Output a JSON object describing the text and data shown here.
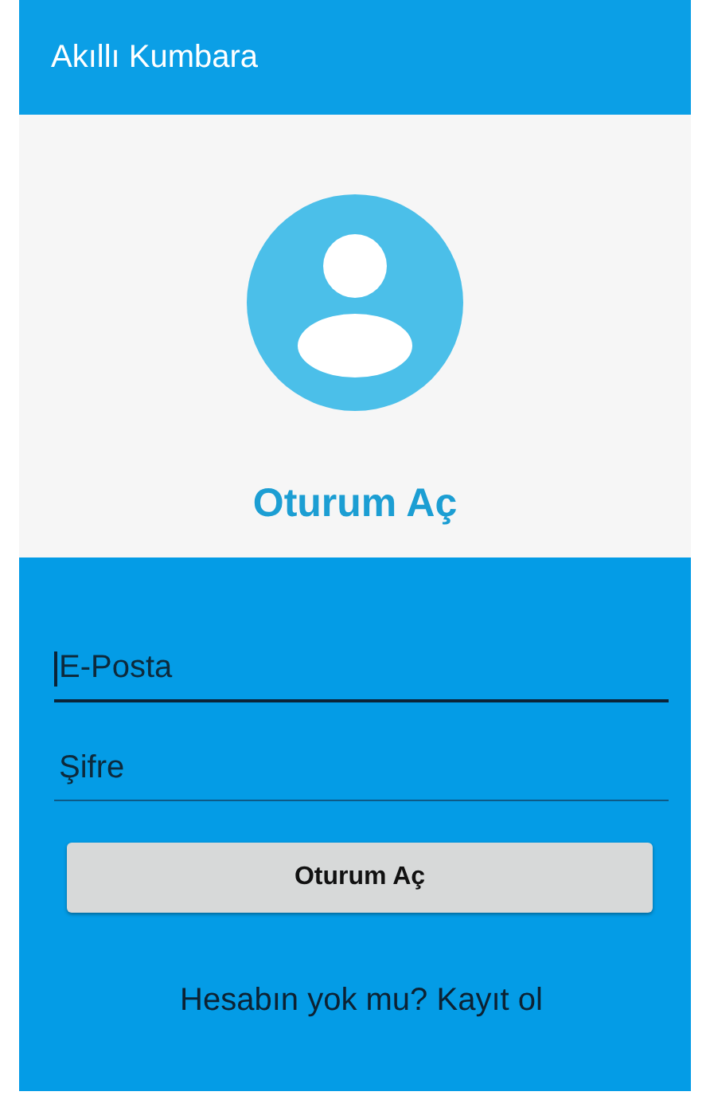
{
  "app_bar": {
    "title": "Akıllı Kumbara"
  },
  "header": {
    "title": "Oturum Aç"
  },
  "fields": [
    {
      "placeholder": "E-Posta",
      "focused": true
    },
    {
      "placeholder": "Şifre",
      "focused": false
    }
  ],
  "login_button": {
    "label": "Oturum Aç"
  },
  "register_link": {
    "label": "Hesabın yok mu? Kayıt ol"
  }
}
